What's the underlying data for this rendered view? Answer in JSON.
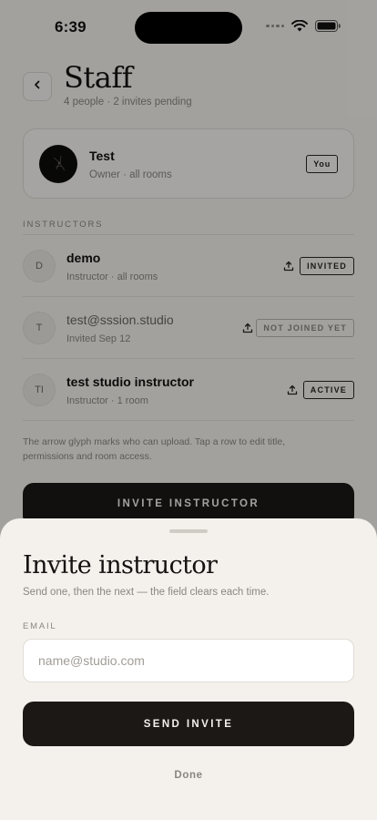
{
  "status_bar": {
    "time": "6:39"
  },
  "header": {
    "title": "Staff",
    "subtitle": "4 people · 2 invites pending"
  },
  "owner": {
    "name": "Test",
    "role": "Owner · all rooms",
    "badge": "You"
  },
  "instructors": {
    "label": "INSTRUCTORS",
    "rows": [
      {
        "initials": "D",
        "name": "demo",
        "detail": "Instructor · all rooms",
        "status": "INVITED",
        "can_upload": true
      },
      {
        "initials": "T",
        "name": "test@sssion.studio",
        "detail": "Invited Sep 12",
        "status": "NOT JOINED YET",
        "can_upload": true
      },
      {
        "initials": "TI",
        "name": "test studio instructor",
        "detail": "Instructor · 1 room",
        "status": "ACTIVE",
        "can_upload": true
      }
    ]
  },
  "footnote": "The arrow glyph marks who can upload. Tap a row to edit title, permissions and room access.",
  "invite_instructor_label": "INVITE INSTRUCTOR",
  "sheet": {
    "title": "Invite instructor",
    "subtitle": "Send one, then the next — the field clears each time.",
    "email_label": "EMAIL",
    "email_value": "",
    "email_placeholder": "name@studio.com",
    "send_label": "SEND INVITE",
    "done_label": "Done"
  },
  "colors": {
    "background": "#f4f1ec",
    "ink": "#1c1815",
    "muted": "#8a8580",
    "scrim": "rgba(0,0,0,0.33)"
  },
  "icons": {
    "back": "chevron-left-icon",
    "upload": "upload-icon",
    "wifi": "wifi-icon",
    "battery": "battery-icon",
    "signal": "signal-icon"
  }
}
